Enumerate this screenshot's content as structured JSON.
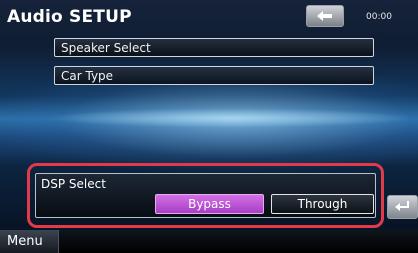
{
  "header": {
    "title": "Audio SETUP",
    "back_icon": "back-arrow-icon",
    "clock": "00:00"
  },
  "settings": {
    "speaker_select_label": "Speaker Select",
    "car_type_label": "Car Type"
  },
  "dsp": {
    "label": "DSP Select",
    "options": [
      "Bypass",
      "Through"
    ],
    "selected": "Bypass"
  },
  "footer": {
    "menu_label": "Menu",
    "return_icon": "return-icon"
  },
  "colors": {
    "highlight_border": "#e33a4a",
    "selected_option": "#c057dc"
  }
}
